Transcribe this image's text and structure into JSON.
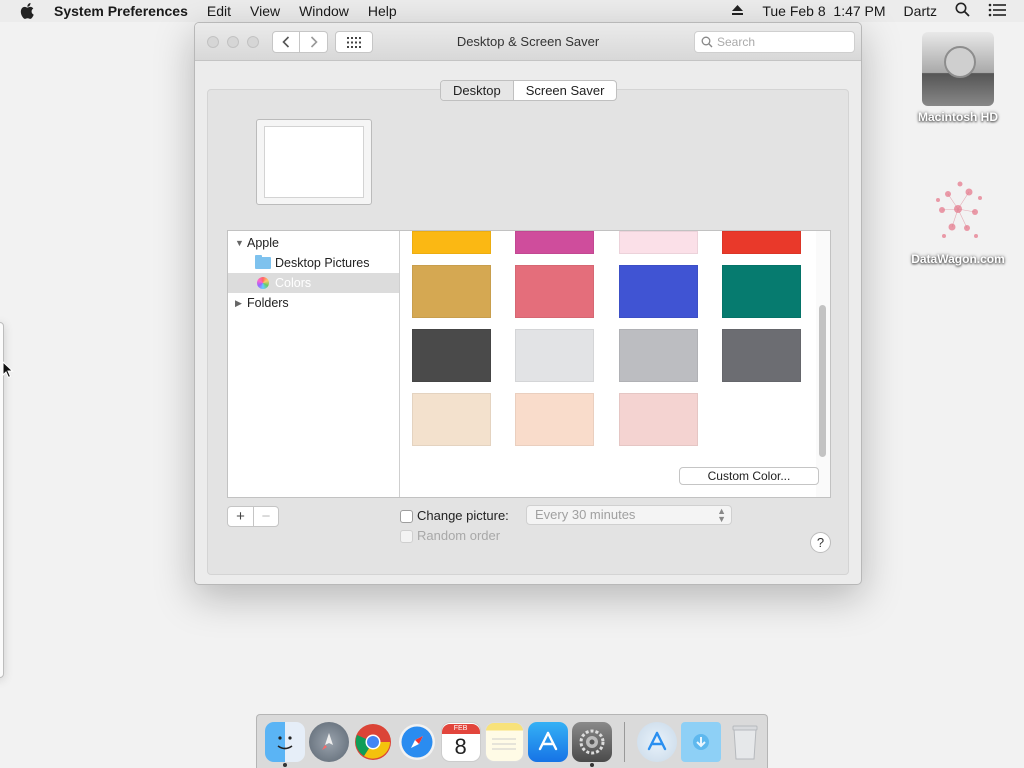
{
  "menubar": {
    "app_name": "System Preferences",
    "menus": [
      "Edit",
      "View",
      "Window",
      "Help"
    ],
    "datetime": "Tue Feb 8  1:47 PM",
    "user": "Dartz"
  },
  "window": {
    "title": "Desktop & Screen Saver",
    "search_placeholder": "Search",
    "tabs": [
      {
        "label": "Desktop",
        "active": true
      },
      {
        "label": "Screen Saver",
        "active": false
      }
    ],
    "source_list": {
      "apple": "Apple",
      "desktop_pictures": "Desktop Pictures",
      "colors": "Colors",
      "folders": "Folders"
    },
    "swatches": [
      "#fbb813",
      "#cf4d9c",
      "#fbe0e8",
      "#e9392a",
      "#d5a852",
      "#e46e7b",
      "#4054d3",
      "#067b6f",
      "#4a4a4a",
      "#e2e3e5",
      "#bcbdc1",
      "#6c6d72",
      "#f3e1cd",
      "#f9dccb",
      "#f4d3d1"
    ],
    "custom_color_label": "Custom Color...",
    "plus_label": "+",
    "minus_label": "−",
    "change_picture_label": "Change picture:",
    "change_interval": "Every 30 minutes",
    "random_order_label": "Random order",
    "help_label": "?"
  },
  "desktop": {
    "hd_label": "Macintosh HD",
    "datawagon_label": "DataWagon.com"
  },
  "dock": {
    "apps": [
      "finder",
      "launchpad",
      "chrome",
      "safari",
      "calendar",
      "notes",
      "app-store",
      "system-preferences"
    ],
    "calendar_month": "FEB",
    "calendar_day": "8",
    "extras": [
      "app-store-installer",
      "downloads-folder",
      "trash"
    ]
  }
}
